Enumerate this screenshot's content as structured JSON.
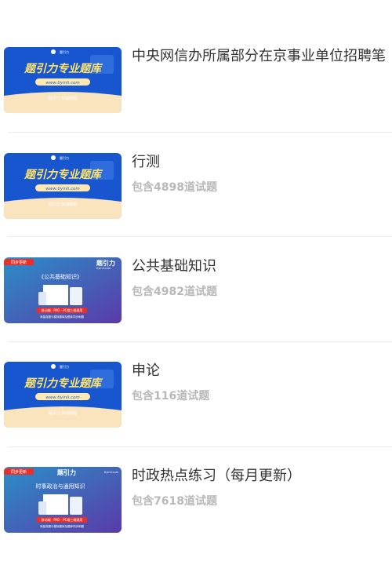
{
  "items": [
    {
      "title": "中央网信办所属部分在京事业单位招聘笔",
      "subtitle": "",
      "thumb": {
        "style": "blue",
        "logo_text": "题引力",
        "headline": "题引力专业题库",
        "url": "www.tiyinli.com",
        "footer": "题引力 快速刷题"
      }
    },
    {
      "title": "行测",
      "subtitle": "包含4898道试题",
      "thumb": {
        "style": "blue",
        "logo_text": "题引力",
        "headline": "题引力专业题库",
        "url": "www.tiyinli.com",
        "footer": "题引力 快速刷题"
      }
    },
    {
      "title": "公共基础知识",
      "subtitle": "包含4982道试题",
      "thumb": {
        "style": "gradient",
        "badge": "同步更新",
        "brand": "题引力",
        "site": "tiyinli.com",
        "headline": "《公共基础知识》",
        "banner": "移动端 · PAD · PC端三端通用",
        "subbanner": "海量真题与模拟题库及题库同步刷题"
      }
    },
    {
      "title": "申论",
      "subtitle": "包含116道试题",
      "thumb": {
        "style": "blue",
        "logo_text": "题引力",
        "headline": "题引力专业题库",
        "url": "www.tiyinli.com",
        "footer": "题引力 快速刷题"
      }
    },
    {
      "title": "时政热点练习（每月更新）",
      "subtitle": "包含7618道试题",
      "thumb": {
        "style": "gradient",
        "badge": "同步更新",
        "brand": "题引力",
        "site": "tiyinli.com",
        "headline": "时事政治与通用知识",
        "banner": "移动端 · PAD · PC端三端通用",
        "subbanner": "海量真题与模拟题库及题库同步刷题"
      }
    }
  ],
  "colors": {
    "blue_bg": "#1d5fd6",
    "blue_dark": "#0f49c0",
    "yellow_headline": "#ffe36b",
    "url_pill": "#ffe9b0",
    "gradient_start": "#2a8fc9",
    "gradient_end": "#5b3aa8",
    "badge_red": "#e8302b",
    "divider": "#ececec"
  }
}
